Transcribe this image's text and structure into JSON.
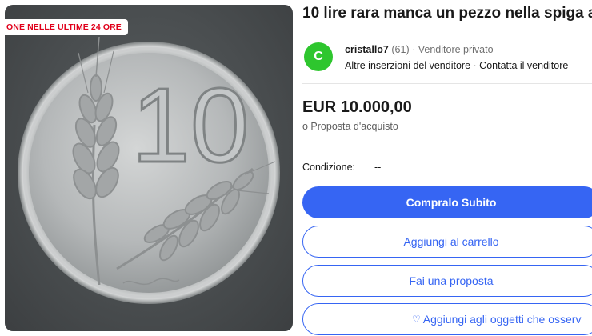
{
  "photo": {
    "banner": "ONE NELLE ULTIME 24 ORE",
    "coin_numeral": "10"
  },
  "listing": {
    "title": "10 lire rara manca un pezzo nella spiga a",
    "seller": {
      "avatar_letter": "C",
      "name": "cristallo7",
      "feedback": "(61)",
      "separator": "·",
      "type": "Venditore privato",
      "other_listings": "Altre inserzioni del venditore",
      "contact": "Contatta il venditore"
    },
    "price": "EUR 10.000,00",
    "offer_note": "o Proposta d'acquisto",
    "condition_label": "Condizione:",
    "condition_value": "--",
    "buttons": {
      "buy_now": "Compralo Subito",
      "add_to_cart": "Aggiungi al carrello",
      "make_offer": "Fai una proposta",
      "watch": "Aggiungi agli oggetti che osserv"
    }
  },
  "colors": {
    "primary_blue": "#3665f3",
    "avatar_green": "#2ec62e",
    "banner_red": "#e0001b"
  }
}
